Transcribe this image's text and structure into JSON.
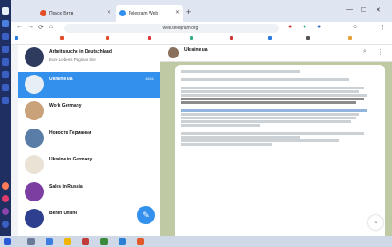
{
  "browser": {
    "tabs": [
      {
        "label": "Поиск Битв",
        "active": false
      },
      {
        "label": "Telegram Web",
        "active": true
      }
    ],
    "address": "web.telegram.org"
  },
  "chat_list": [
    {
      "name": "Arbeitssuche in Deutschland",
      "preview": "Eure Lebens Paginas Sie",
      "time": "",
      "badge": "",
      "selected": false,
      "avatar_color": "#2e3b5e"
    },
    {
      "name": "Ukraine ua",
      "preview": "",
      "time": "16:41",
      "badge": "",
      "selected": true,
      "avatar_color": "#e8eef5"
    },
    {
      "name": "Work Germany",
      "preview": "",
      "time": "",
      "badge": "",
      "selected": false,
      "avatar_color": "#c9a27a"
    },
    {
      "name": "Новости Германии",
      "preview": "",
      "time": "",
      "badge": "",
      "selected": false,
      "avatar_color": "#5a7da8"
    },
    {
      "name": "Ukraine in Germany",
      "preview": "",
      "time": "",
      "badge": "",
      "selected": false,
      "avatar_color": "#e9e2d5"
    },
    {
      "name": "Sales in Russia",
      "preview": "",
      "time": "",
      "badge": "",
      "selected": false,
      "avatar_color": "#7a3fa0"
    },
    {
      "name": "Berlin Online",
      "preview": "",
      "time": "",
      "badge": "",
      "selected": false,
      "avatar_color": "#2f3f8f"
    }
  ],
  "chat": {
    "title": "Ukraine ua",
    "subtitle": ""
  },
  "colors": {
    "accent": "#3390ec",
    "chat_background": "#bfc9a4"
  }
}
